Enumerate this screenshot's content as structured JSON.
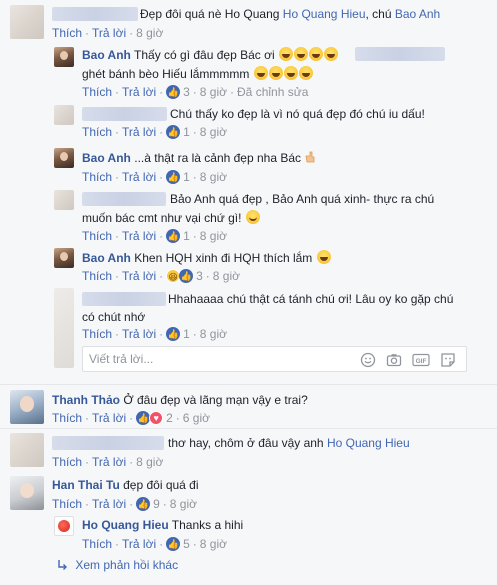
{
  "comments": {
    "c1": {
      "text": "Đẹp đôi quá nè Ho Quang ",
      "mention1": "Ho Quang Hieu",
      "sep": ", chú ",
      "mention2": "Bao Anh",
      "like": "Thích",
      "reply": "Trả lời",
      "time": "8 giờ"
    },
    "r1": {
      "name": "Bao Anh",
      "text1": "Thấy có gì đâu đẹp Bác ơi",
      "text2": "ghét bánh bèo Hiếu lắmmmmm",
      "like": "Thích",
      "reply": "Trả lời",
      "likes": "3",
      "time": "8 giờ",
      "edited": "Đã chỉnh sửa"
    },
    "r2": {
      "text": "Chú thấy ko đẹp là vì nó quá đẹp đó chú iu dấu!",
      "like": "Thích",
      "reply": "Trả lời",
      "likes": "1",
      "time": "8 giờ"
    },
    "r3": {
      "name": "Bao Anh",
      "text": "...à thật ra là cảnh đẹp nha Bác",
      "like": "Thích",
      "reply": "Trả lời",
      "likes": "1",
      "time": "8 giờ"
    },
    "r4": {
      "text1": "Bảo Anh quá đẹp , Bảo Anh quá xinh- thực ra chú",
      "text2": "muốn bác cmt như vại chứ gì!",
      "like": "Thích",
      "reply": "Trả lời",
      "likes": "1",
      "time": "8 giờ"
    },
    "r5": {
      "name": "Bao Anh",
      "text": "Khen HQH xinh đi HQH thích lắm",
      "like": "Thích",
      "reply": "Trả lời",
      "likes": "3",
      "time": "8 giờ"
    },
    "r6": {
      "text1": "Hhahaaaa chú thật cá tánh chú ơi! Lâu oy ko gặp chú",
      "text2": "có chút nhớ",
      "like": "Thích",
      "reply": "Trả lời",
      "likes": "1",
      "time": "8 giờ"
    },
    "c2": {
      "name": "Thanh Thảo",
      "text": "Ở đâu đẹp và lãng mạn vậy e trai?",
      "like": "Thích",
      "reply": "Trả lời",
      "likes": "2",
      "time": "6 giờ"
    },
    "c3": {
      "text": "thơ hay, chôm ở đâu vậy anh ",
      "mention": "Ho Quang Hieu",
      "like": "Thích",
      "reply": "Trả lời",
      "time": "8 giờ"
    },
    "c4": {
      "name": "Han Thai Tu",
      "text": "đẹp đôi quá đi",
      "like": "Thích",
      "reply": "Trả lời",
      "likes": "9",
      "time": "8 giờ"
    },
    "r7": {
      "name": "Ho Quang Hieu",
      "text": "Thanks a hihi",
      "like": "Thích",
      "reply": "Trả lời",
      "likes": "5",
      "time": "8 giờ"
    }
  },
  "reply_box": {
    "placeholder": "Viết trả lời..."
  },
  "more_replies": "Xem phản hồi khác",
  "dot": "·"
}
